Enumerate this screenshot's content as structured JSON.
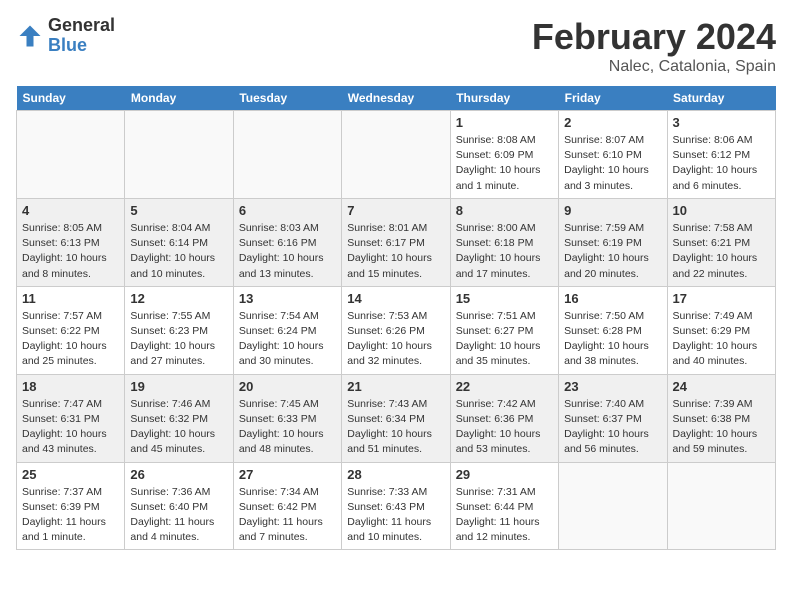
{
  "header": {
    "logo_general": "General",
    "logo_blue": "Blue",
    "title": "February 2024",
    "location": "Nalec, Catalonia, Spain"
  },
  "days_of_week": [
    "Sunday",
    "Monday",
    "Tuesday",
    "Wednesday",
    "Thursday",
    "Friday",
    "Saturday"
  ],
  "weeks": [
    [
      {
        "day": "",
        "sunrise": "",
        "sunset": "",
        "daylight": ""
      },
      {
        "day": "",
        "sunrise": "",
        "sunset": "",
        "daylight": ""
      },
      {
        "day": "",
        "sunrise": "",
        "sunset": "",
        "daylight": ""
      },
      {
        "day": "",
        "sunrise": "",
        "sunset": "",
        "daylight": ""
      },
      {
        "day": "1",
        "sunrise": "Sunrise: 8:08 AM",
        "sunset": "Sunset: 6:09 PM",
        "daylight": "Daylight: 10 hours and 1 minute."
      },
      {
        "day": "2",
        "sunrise": "Sunrise: 8:07 AM",
        "sunset": "Sunset: 6:10 PM",
        "daylight": "Daylight: 10 hours and 3 minutes."
      },
      {
        "day": "3",
        "sunrise": "Sunrise: 8:06 AM",
        "sunset": "Sunset: 6:12 PM",
        "daylight": "Daylight: 10 hours and 6 minutes."
      }
    ],
    [
      {
        "day": "4",
        "sunrise": "Sunrise: 8:05 AM",
        "sunset": "Sunset: 6:13 PM",
        "daylight": "Daylight: 10 hours and 8 minutes."
      },
      {
        "day": "5",
        "sunrise": "Sunrise: 8:04 AM",
        "sunset": "Sunset: 6:14 PM",
        "daylight": "Daylight: 10 hours and 10 minutes."
      },
      {
        "day": "6",
        "sunrise": "Sunrise: 8:03 AM",
        "sunset": "Sunset: 6:16 PM",
        "daylight": "Daylight: 10 hours and 13 minutes."
      },
      {
        "day": "7",
        "sunrise": "Sunrise: 8:01 AM",
        "sunset": "Sunset: 6:17 PM",
        "daylight": "Daylight: 10 hours and 15 minutes."
      },
      {
        "day": "8",
        "sunrise": "Sunrise: 8:00 AM",
        "sunset": "Sunset: 6:18 PM",
        "daylight": "Daylight: 10 hours and 17 minutes."
      },
      {
        "day": "9",
        "sunrise": "Sunrise: 7:59 AM",
        "sunset": "Sunset: 6:19 PM",
        "daylight": "Daylight: 10 hours and 20 minutes."
      },
      {
        "day": "10",
        "sunrise": "Sunrise: 7:58 AM",
        "sunset": "Sunset: 6:21 PM",
        "daylight": "Daylight: 10 hours and 22 minutes."
      }
    ],
    [
      {
        "day": "11",
        "sunrise": "Sunrise: 7:57 AM",
        "sunset": "Sunset: 6:22 PM",
        "daylight": "Daylight: 10 hours and 25 minutes."
      },
      {
        "day": "12",
        "sunrise": "Sunrise: 7:55 AM",
        "sunset": "Sunset: 6:23 PM",
        "daylight": "Daylight: 10 hours and 27 minutes."
      },
      {
        "day": "13",
        "sunrise": "Sunrise: 7:54 AM",
        "sunset": "Sunset: 6:24 PM",
        "daylight": "Daylight: 10 hours and 30 minutes."
      },
      {
        "day": "14",
        "sunrise": "Sunrise: 7:53 AM",
        "sunset": "Sunset: 6:26 PM",
        "daylight": "Daylight: 10 hours and 32 minutes."
      },
      {
        "day": "15",
        "sunrise": "Sunrise: 7:51 AM",
        "sunset": "Sunset: 6:27 PM",
        "daylight": "Daylight: 10 hours and 35 minutes."
      },
      {
        "day": "16",
        "sunrise": "Sunrise: 7:50 AM",
        "sunset": "Sunset: 6:28 PM",
        "daylight": "Daylight: 10 hours and 38 minutes."
      },
      {
        "day": "17",
        "sunrise": "Sunrise: 7:49 AM",
        "sunset": "Sunset: 6:29 PM",
        "daylight": "Daylight: 10 hours and 40 minutes."
      }
    ],
    [
      {
        "day": "18",
        "sunrise": "Sunrise: 7:47 AM",
        "sunset": "Sunset: 6:31 PM",
        "daylight": "Daylight: 10 hours and 43 minutes."
      },
      {
        "day": "19",
        "sunrise": "Sunrise: 7:46 AM",
        "sunset": "Sunset: 6:32 PM",
        "daylight": "Daylight: 10 hours and 45 minutes."
      },
      {
        "day": "20",
        "sunrise": "Sunrise: 7:45 AM",
        "sunset": "Sunset: 6:33 PM",
        "daylight": "Daylight: 10 hours and 48 minutes."
      },
      {
        "day": "21",
        "sunrise": "Sunrise: 7:43 AM",
        "sunset": "Sunset: 6:34 PM",
        "daylight": "Daylight: 10 hours and 51 minutes."
      },
      {
        "day": "22",
        "sunrise": "Sunrise: 7:42 AM",
        "sunset": "Sunset: 6:36 PM",
        "daylight": "Daylight: 10 hours and 53 minutes."
      },
      {
        "day": "23",
        "sunrise": "Sunrise: 7:40 AM",
        "sunset": "Sunset: 6:37 PM",
        "daylight": "Daylight: 10 hours and 56 minutes."
      },
      {
        "day": "24",
        "sunrise": "Sunrise: 7:39 AM",
        "sunset": "Sunset: 6:38 PM",
        "daylight": "Daylight: 10 hours and 59 minutes."
      }
    ],
    [
      {
        "day": "25",
        "sunrise": "Sunrise: 7:37 AM",
        "sunset": "Sunset: 6:39 PM",
        "daylight": "Daylight: 11 hours and 1 minute."
      },
      {
        "day": "26",
        "sunrise": "Sunrise: 7:36 AM",
        "sunset": "Sunset: 6:40 PM",
        "daylight": "Daylight: 11 hours and 4 minutes."
      },
      {
        "day": "27",
        "sunrise": "Sunrise: 7:34 AM",
        "sunset": "Sunset: 6:42 PM",
        "daylight": "Daylight: 11 hours and 7 minutes."
      },
      {
        "day": "28",
        "sunrise": "Sunrise: 7:33 AM",
        "sunset": "Sunset: 6:43 PM",
        "daylight": "Daylight: 11 hours and 10 minutes."
      },
      {
        "day": "29",
        "sunrise": "Sunrise: 7:31 AM",
        "sunset": "Sunset: 6:44 PM",
        "daylight": "Daylight: 11 hours and 12 minutes."
      },
      {
        "day": "",
        "sunrise": "",
        "sunset": "",
        "daylight": ""
      },
      {
        "day": "",
        "sunrise": "",
        "sunset": "",
        "daylight": ""
      }
    ]
  ]
}
